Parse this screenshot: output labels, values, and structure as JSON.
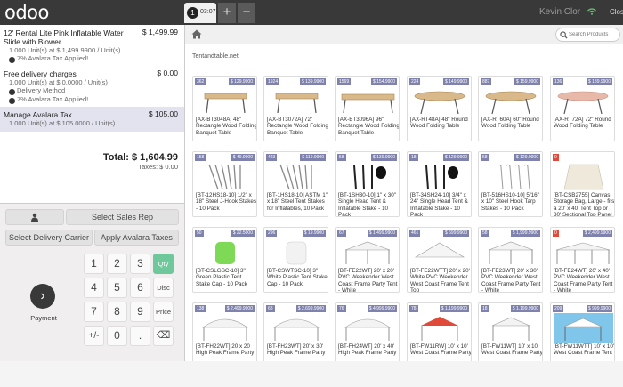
{
  "app": {
    "logo": "odoo"
  },
  "header": {
    "order_tab": {
      "number": "1",
      "time": "03:07"
    },
    "add_label": "+",
    "remove_label": "−",
    "user": "Kevin Clor",
    "close_label": "Close"
  },
  "order": {
    "lines": [
      {
        "name": "12' Rental Lite Pink Inflatable Water Slide with Blower",
        "price": "$ 1,499.99",
        "qty_detail": "1.000 Unit(s) at $ 1,499.9900 / Unit(s)",
        "notes": [
          "7% Avalara Tax Applied!"
        ]
      },
      {
        "name": "Free delivery charges",
        "price": "$ 0.00",
        "qty_detail": "1.000 Unit(s) at $ 0.0000 / Unit(s)",
        "notes": [
          "Delivery Method",
          "7% Avalara Tax Applied!"
        ]
      },
      {
        "name": "Manage Avalara Tax",
        "price": "$ 105.00",
        "qty_detail": "1.000 Unit(s) at $ 105.0000 / Unit(s)",
        "notes": []
      }
    ],
    "total": "Total: $ 1,604.99",
    "taxes": "Taxes: $ 0.00"
  },
  "controls": {
    "customer_icon": "person-icon",
    "select_sales_rep": "Select Sales Rep",
    "select_delivery_carrier": "Select Delivery Carrier",
    "apply_avalara_taxes": "Apply Avalara Taxes",
    "payment": "Payment",
    "keys": [
      "1",
      "2",
      "3",
      "4",
      "5",
      "6",
      "7",
      "8",
      "9",
      "+/-",
      "0",
      "."
    ],
    "mode_qty": "Qty",
    "mode_disc": "Disc",
    "mode_price": "Price",
    "backspace": "⌫"
  },
  "products_panel": {
    "search_placeholder": "Search Products",
    "category": "Tentandtable.net",
    "products": [
      {
        "code": "362",
        "price": "$ 129.9900",
        "name": "[AX-BT3048A] 48\" Rectangle Wood Folding Banquet Table",
        "thumb": "table"
      },
      {
        "code": "1924",
        "price": "$ 139.9900",
        "name": "[AX-BT3072A] 72\" Rectangle Wood Folding Banquet Table",
        "thumb": "table"
      },
      {
        "code": "1569",
        "price": "$ 154.9900",
        "name": "[AX-BT3096A] 96\" Rectangle Wood Folding Banquet Table",
        "thumb": "table-long"
      },
      {
        "code": "224",
        "price": "$ 149.9900",
        "name": "[AX-RT48A] 48\" Round Wood Folding Table",
        "thumb": "round-table"
      },
      {
        "code": "887",
        "price": "$ 159.9900",
        "name": "[AX-RT60A] 60\" Round Wood Folding Table",
        "thumb": "round-table"
      },
      {
        "code": "136",
        "price": "$ 189.9900",
        "name": "[AX-RT72A] 72\" Round Wood Folding Table",
        "thumb": "round-table-pink"
      },
      {
        "code": "158",
        "price": "$ 49.9900",
        "name": "[BT-12HS18-10] 1/2\" x 18\" Steel J-Hook Stakes - 10 Pack",
        "thumb": "stakes"
      },
      {
        "code": "423",
        "price": "$ 119.9900",
        "name": "[BT-1HS18-10] ASTM 1\" x 18\" Steel Tent Stakes for Inflatables, 10 Pack",
        "thumb": "stakes"
      },
      {
        "code": "58",
        "price": "$ 139.9900",
        "name": "[BT-1SH30-10] 1\" x 30\" Single Head Tent & Inflatable Stake - 10 Pack",
        "thumb": "stakes-dark"
      },
      {
        "code": "18",
        "price": "$ 129.9900",
        "name": "[BT-34SH24-10] 3/4\" x 24\" Single Head Tent & Inflatable Stake - 10 Pack",
        "thumb": "stakes-dark"
      },
      {
        "code": "58",
        "price": "$ 129.9900",
        "name": "[BT-516HS10-10] 5/16\" x 10\" Steel Hook Tarp Stakes - 10 Pack",
        "thumb": "hooks"
      },
      {
        "code": "0",
        "price": "",
        "name": "[BT-CSB2755] Canvas Storage Bag, Large - fits a 20' x 40' Tent Top or 30' Sectional Top Panel",
        "thumb": "bag",
        "red": true
      },
      {
        "code": "50",
        "price": "$ 22.5000",
        "name": "[BT-CSLGSC-10] 3\" Green Plastic Tent Stake Cap - 10 Pack",
        "thumb": "cap-green"
      },
      {
        "code": "296",
        "price": "$ 19.9900",
        "name": "[BT-CSWTSC-10] 3\" White Plastic Tent Stake Cap - 10 Pack",
        "thumb": "cap-white"
      },
      {
        "code": "67",
        "price": "$ 1,499.9900",
        "name": "[BT-FE22WT] 20' x 20' PVC Weekender West Coast Frame Party Tent - White",
        "thumb": "tent"
      },
      {
        "code": "461",
        "price": "$ 699.9900",
        "name": "[BT-FE22WTT] 20' x 20' White PVC Weekender West Coast Frame Tent Top",
        "thumb": "tent-top"
      },
      {
        "code": "58",
        "price": "$ 1,999.9900",
        "name": "[BT-FE23WT] 20' x 30' PVC Weekender West Coast Frame Party Tent - White",
        "thumb": "tent"
      },
      {
        "code": "0",
        "price": "$ 2,499.9900",
        "name": "[BT-FE24WT] 20' x 40' PVC Weekender West Coast Frame Party Tent - White",
        "thumb": "tent-long",
        "red": true
      },
      {
        "code": "138",
        "price": "$ 2,499.9900",
        "name": "[BT-FH22WT] 20 x 20 High Peak Frame Party",
        "thumb": "tent-peak"
      },
      {
        "code": "68",
        "price": "$ 2,699.9900",
        "name": "[BT-FH23WT] 20' x 30' High Peak Frame Party",
        "thumb": "tent-peak"
      },
      {
        "code": "76",
        "price": "$ 4,999.9900",
        "name": "[BT-FH24WT] 20' x 40' High Peak Frame Party",
        "thumb": "tent-peak"
      },
      {
        "code": "78",
        "price": "$ 1,199.9900",
        "name": "[BT-FW11RW] 10' x 10' West Coast Frame Party",
        "thumb": "tent-red"
      },
      {
        "code": "18",
        "price": "$ 1,199.9900",
        "name": "[BT-FW11WT] 10' x 10' West Coast Frame Party",
        "thumb": "tent-small"
      },
      {
        "code": "209",
        "price": "$ 999.9900",
        "name": "[BT-FW11WTT] 10' x 10' West Coast Frame Tent",
        "thumb": "tent-blue"
      }
    ]
  }
}
